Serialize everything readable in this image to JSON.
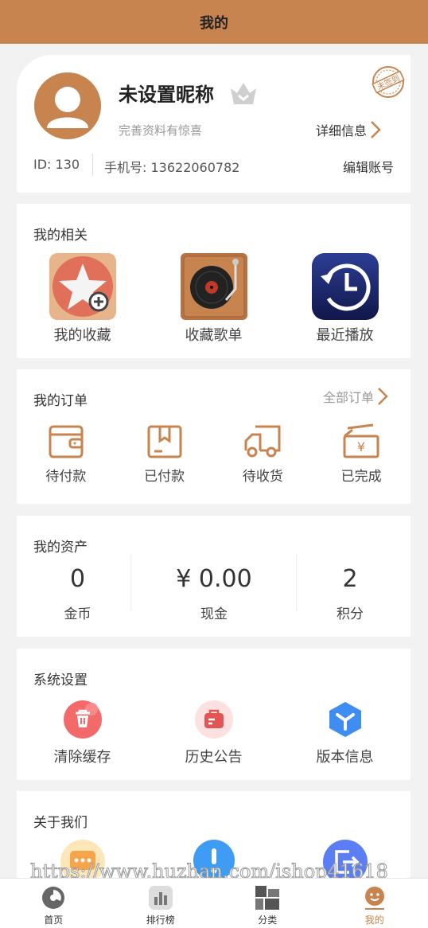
{
  "header": {
    "title": "我的"
  },
  "profile": {
    "nickname": "未设置昵称",
    "subtitle": "完善资料有惊喜",
    "detail_link": "详细信息",
    "id_text": "ID: 130",
    "phone_text": "手机号: 13622060782",
    "edit_link": "编辑账号",
    "stamp_text": "未签到"
  },
  "related": {
    "title": "我的相关",
    "items": [
      {
        "label": "我的收藏",
        "icon": "favorites-star-icon"
      },
      {
        "label": "收藏歌单",
        "icon": "record-player-icon"
      },
      {
        "label": "最近播放",
        "icon": "recent-clock-icon"
      }
    ]
  },
  "orders": {
    "title": "我的订单",
    "more": "全部订单",
    "items": [
      {
        "label": "待付款",
        "icon": "wallet-icon"
      },
      {
        "label": "已付款",
        "icon": "box-icon"
      },
      {
        "label": "待收货",
        "icon": "truck-icon"
      },
      {
        "label": "已完成",
        "icon": "yen-box-icon"
      }
    ]
  },
  "assets": {
    "title": "我的资产",
    "items": [
      {
        "value": "0",
        "label": "金币"
      },
      {
        "value": "¥ 0.00",
        "label": "现金"
      },
      {
        "value": "2",
        "label": "积分"
      }
    ]
  },
  "settings": {
    "title": "系统设置",
    "items": [
      {
        "label": "清除缓存",
        "icon": "trash-icon"
      },
      {
        "label": "历史公告",
        "icon": "notice-bag-icon"
      },
      {
        "label": "版本信息",
        "icon": "version-cube-icon"
      }
    ]
  },
  "about": {
    "title": "关于我们",
    "icons": [
      "chat-bubble-icon",
      "alert-icon",
      "logout-icon"
    ]
  },
  "watermark": "https://www.huzhan.com/ishop41618",
  "tabbar": {
    "items": [
      {
        "label": "首页",
        "icon": "home-pie-icon"
      },
      {
        "label": "排行榜",
        "icon": "rank-bars-icon"
      },
      {
        "label": "分类",
        "icon": "category-grid-icon"
      },
      {
        "label": "我的",
        "icon": "profile-face-icon",
        "active": true
      }
    ]
  },
  "colors": {
    "accent": "#c8844f",
    "background": "#f2f2f2"
  }
}
